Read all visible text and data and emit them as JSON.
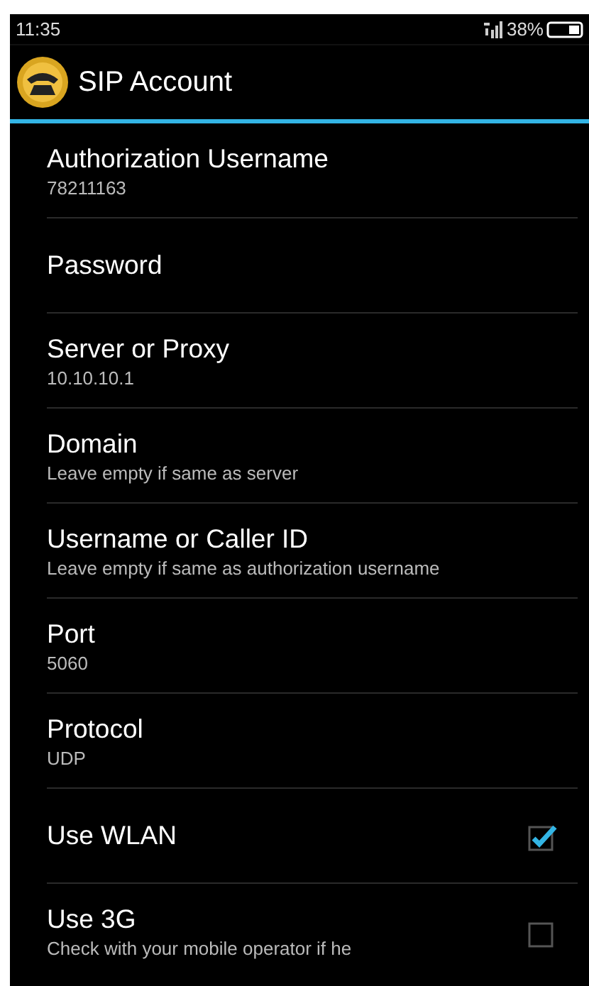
{
  "status_bar": {
    "time": "11:35",
    "battery": "38%"
  },
  "title_bar": {
    "title": "SIP Account"
  },
  "settings": [
    {
      "kind": "text",
      "title": "Authorization Username",
      "summary": "78211163"
    },
    {
      "kind": "text",
      "title": "Password"
    },
    {
      "kind": "text",
      "title": "Server or Proxy",
      "summary": "10.10.10.1"
    },
    {
      "kind": "text",
      "title": "Domain",
      "summary": "Leave empty if same as server"
    },
    {
      "kind": "text",
      "title": "Username or Caller ID",
      "summary": "Leave empty if same as authorization username"
    },
    {
      "kind": "text",
      "title": "Port",
      "summary": "5060"
    },
    {
      "kind": "text",
      "title": "Protocol",
      "summary": "UDP"
    },
    {
      "kind": "checkbox",
      "title": "Use WLAN",
      "checked": true
    },
    {
      "kind": "checkbox",
      "title": "Use 3G",
      "summary": "Check with your mobile operator if he",
      "checked": false
    }
  ]
}
